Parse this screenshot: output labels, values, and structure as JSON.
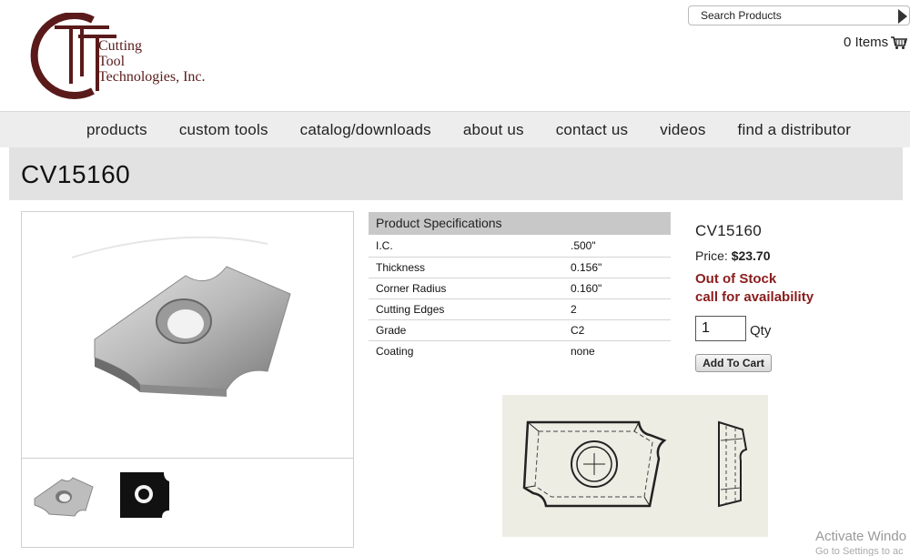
{
  "header": {
    "logo_lines": [
      "Cutting",
      "Tool",
      "Technologies, Inc."
    ],
    "search_placeholder": "Search Products",
    "cart_label": "0 Items"
  },
  "nav": {
    "items": [
      "products",
      "custom tools",
      "catalog/downloads",
      "about us",
      "contact us",
      "videos",
      "find a distributor"
    ]
  },
  "product": {
    "title": "CV15160",
    "name": "CV15160",
    "price_label": "Price:",
    "price": "$23.70",
    "stock_line1": "Out of Stock",
    "stock_line2": "call for availability",
    "qty_value": "1",
    "qty_label": "Qty",
    "add_to_cart_label": "Add To Cart"
  },
  "specs": {
    "heading": "Product Specifications",
    "rows": [
      {
        "label": "I.C.",
        "value": ".500\""
      },
      {
        "label": "Thickness",
        "value": "0.156\""
      },
      {
        "label": "Corner Radius",
        "value": "0.160\""
      },
      {
        "label": "Cutting Edges",
        "value": "2"
      },
      {
        "label": "Grade",
        "value": "C2"
      },
      {
        "label": "Coating",
        "value": "none"
      }
    ]
  },
  "watermark": {
    "line1": "Activate Windo",
    "line2": "Go to Settings to ac"
  },
  "colors": {
    "brand": "#5a1a1a",
    "stock_alert": "#8b1c1c",
    "nav_bg": "#ededed",
    "title_band": "#e2e2e2"
  },
  "icons": [
    "logo-mark",
    "search-arrow-icon",
    "cart-icon",
    "insert-photo",
    "insert-thumb-photo",
    "insert-thumb-dark",
    "insert-drawing"
  ]
}
